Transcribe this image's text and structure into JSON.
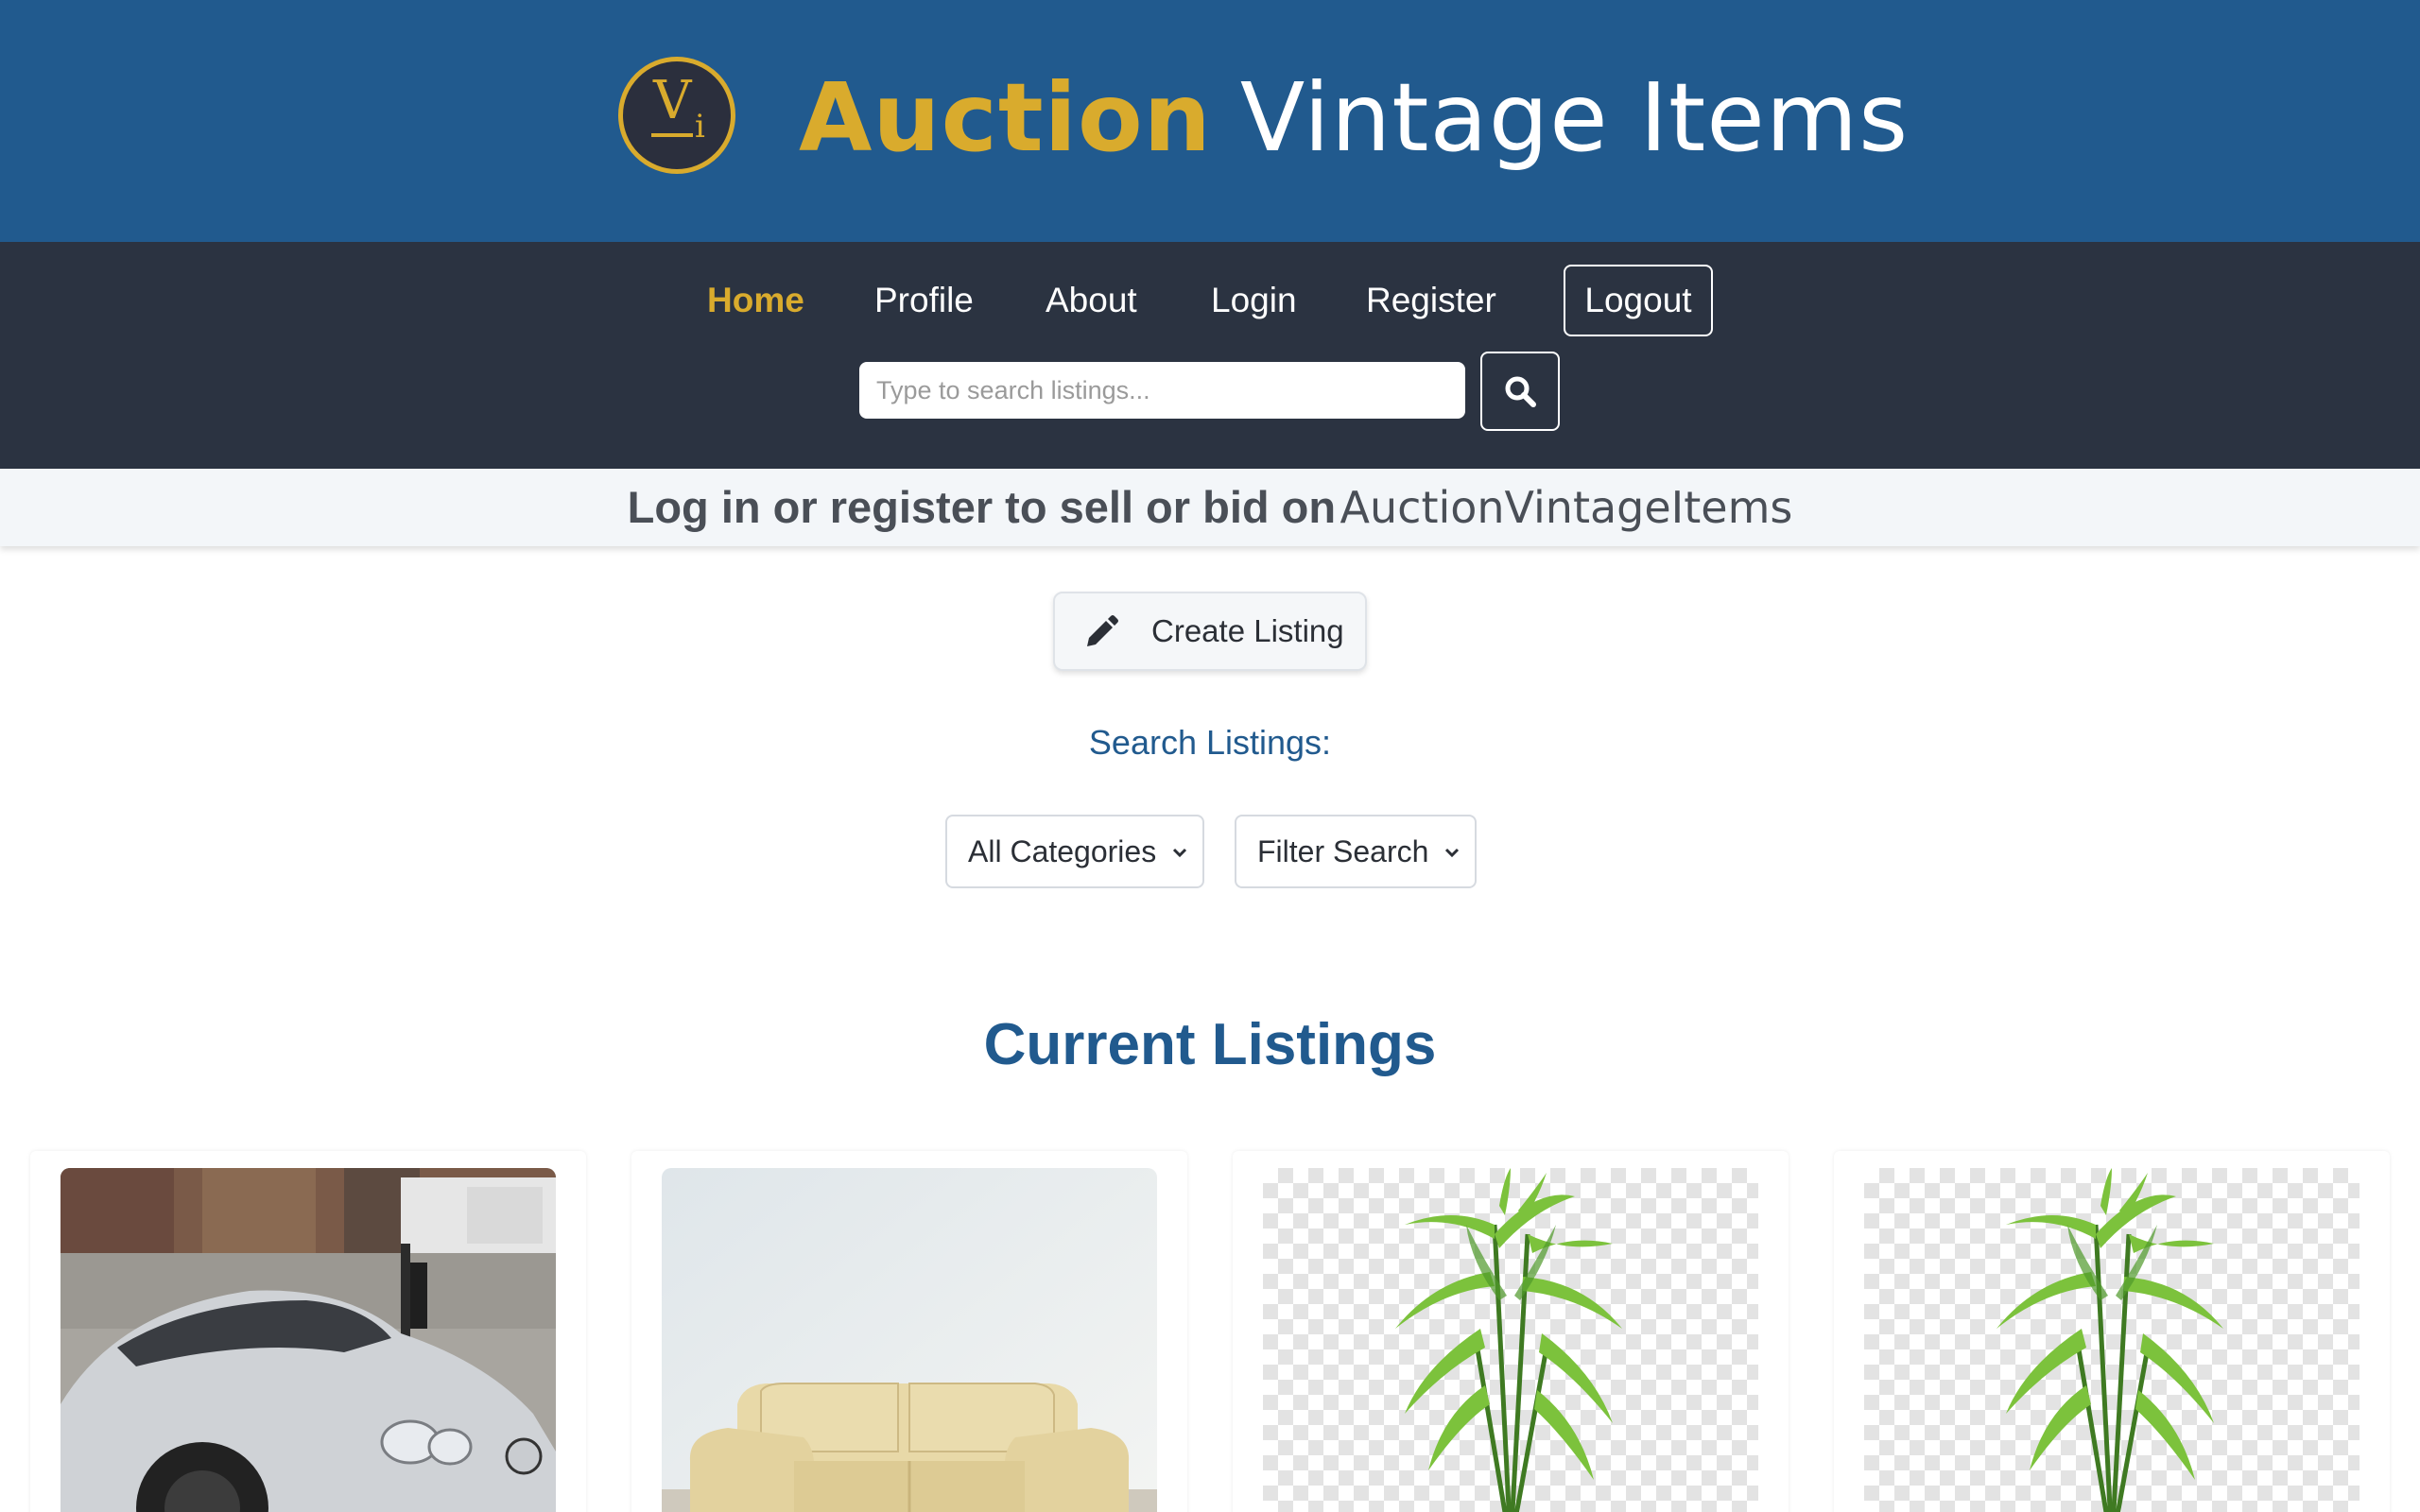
{
  "header": {
    "logo_text": "Vi",
    "brand_accent": "Auction",
    "brand_rest": "Vintage Items"
  },
  "nav": {
    "items": [
      {
        "label": "Home",
        "active": true
      },
      {
        "label": "Profile",
        "active": false
      },
      {
        "label": "About",
        "active": false
      },
      {
        "label": "Login",
        "active": false
      },
      {
        "label": "Register",
        "active": false
      }
    ],
    "logout_label": "Logout"
  },
  "search": {
    "placeholder": "Type to search listings...",
    "value": "",
    "button_icon": "search-icon"
  },
  "notice": {
    "text": "Log in or register to sell or bid on",
    "brand": "AuctionVintageItems"
  },
  "create_listing": {
    "label": "Create Listing",
    "icon": "pencil-icon"
  },
  "filters": {
    "heading": "Search Listings:",
    "category_selected": "All Categories",
    "filter_selected": "Filter Search"
  },
  "listings": {
    "heading": "Current Listings",
    "items": [
      {
        "image": "silver sports car photo"
      },
      {
        "image": "cream leather sofa photo"
      },
      {
        "image": "potted bamboo plant photo"
      },
      {
        "image": "potted bamboo plant photo"
      }
    ]
  },
  "colors": {
    "banner_blue": "#215a8e",
    "nav_dark": "#2b3341",
    "gold_accent": "#d9ab2d"
  }
}
